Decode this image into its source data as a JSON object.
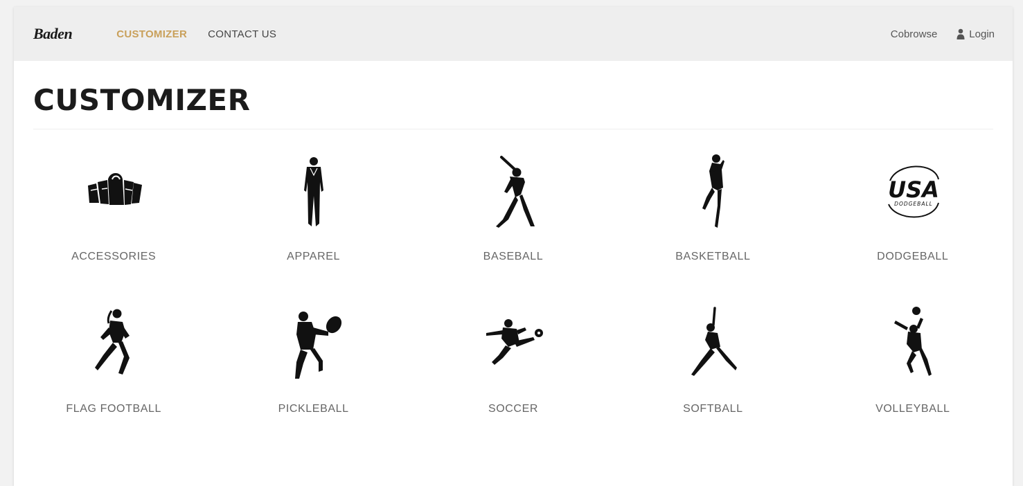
{
  "nav": {
    "brand": "Baden",
    "links": [
      "CUSTOMIZER",
      "CONTACT US"
    ],
    "cobrowse": "Cobrowse",
    "login": "Login",
    "accent_color": "#c9a05a"
  },
  "page": {
    "title": "CUSTOMIZER"
  },
  "categories": [
    {
      "label": "ACCESSORIES",
      "icon": "bags-icon"
    },
    {
      "label": "APPAREL",
      "icon": "apparel-figure-icon"
    },
    {
      "label": "BASEBALL",
      "icon": "baseball-batter-icon"
    },
    {
      "label": "BASKETBALL",
      "icon": "basketball-player-icon"
    },
    {
      "label": "DODGEBALL",
      "icon": "usa-dodgeball-logo-icon"
    },
    {
      "label": "FLAG FOOTBALL",
      "icon": "flag-football-player-icon"
    },
    {
      "label": "PICKLEBALL",
      "icon": "pickleball-player-icon"
    },
    {
      "label": "SOCCER",
      "icon": "soccer-player-icon"
    },
    {
      "label": "SOFTBALL",
      "icon": "softball-pitcher-icon"
    },
    {
      "label": "VOLLEYBALL",
      "icon": "volleyball-player-icon"
    }
  ],
  "dodgeball_logo": {
    "main": "USA",
    "sub": "DODGEBALL"
  }
}
